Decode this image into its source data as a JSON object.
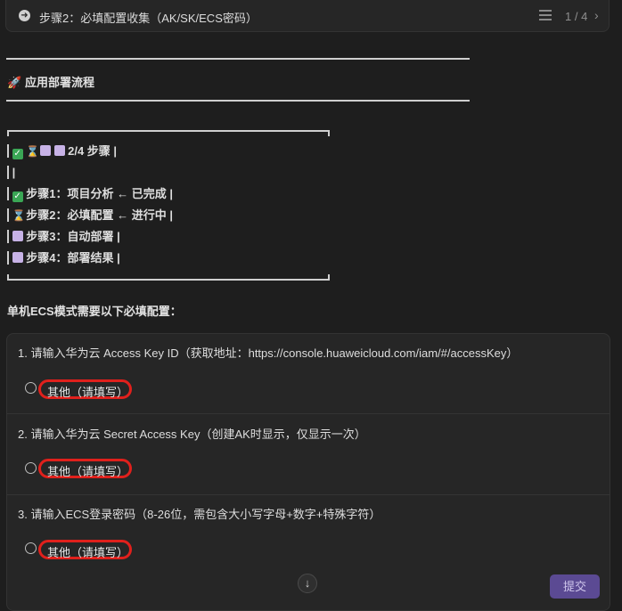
{
  "step_header": {
    "title": "步骤2：必填配置收集（AK/SK/ECS密码）",
    "counter": "1 / 4"
  },
  "section": {
    "icon": "🚀",
    "title": "应用部署流程"
  },
  "progress": {
    "summary": "2/4 步骤 |",
    "empty_line": "|",
    "steps": [
      {
        "status": "done",
        "text": "步骤1：项目分析 ← 已完成 |"
      },
      {
        "status": "in-progress",
        "text": "步骤2：必填配置 ← 进行中 |"
      },
      {
        "status": "todo",
        "text": "步骤3：自动部署 |"
      },
      {
        "status": "todo",
        "text": "步骤4：部署结果 |"
      }
    ]
  },
  "requirement_text": "单机ECS模式需要以下必填配置：",
  "questions": [
    {
      "text": "1. 请输入华为云 Access Key ID（获取地址：https://console.huaweicloud.com/iam/#/accessKey）",
      "option": "其他（请填写）"
    },
    {
      "text": "2. 请输入华为云 Secret Access Key（创建AK时显示，仅显示一次）",
      "option": "其他（请填写）"
    },
    {
      "text": "3. 请输入ECS登录密码（8-26位，需包含大小写字母+数字+特殊字符）",
      "option": "其他（请填写）"
    }
  ],
  "submit_label": "提交",
  "colors": {
    "background": "#1e1e1e",
    "card": "#262626",
    "highlight": "#e0201c",
    "submit": "#5b4a93",
    "done": "#3aa655",
    "todo": "#c7b2e6"
  }
}
